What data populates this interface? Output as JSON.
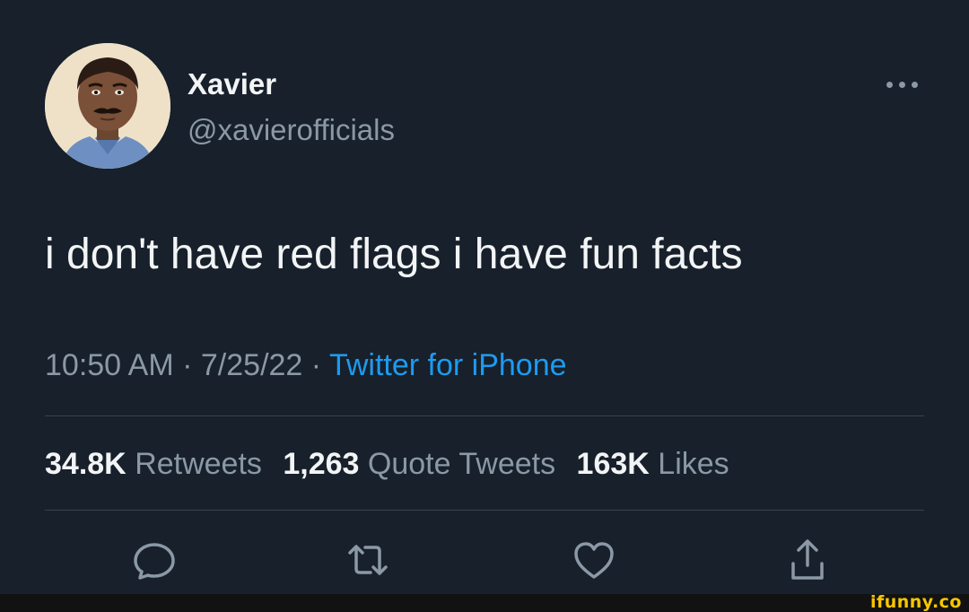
{
  "author": {
    "display_name": "Xavier",
    "handle": "@xavierofficials"
  },
  "tweet": {
    "text": "i don't have red flags i have fun facts",
    "time": "10:50 AM",
    "date": "7/25/22",
    "separator": "·",
    "source": "Twitter for iPhone"
  },
  "stats": {
    "retweets": {
      "count": "34.8K",
      "label": "Retweets"
    },
    "quotes": {
      "count": "1,263",
      "label": "Quote Tweets"
    },
    "likes": {
      "count": "163K",
      "label": "Likes"
    }
  },
  "actions": {
    "icons": [
      "reply-icon",
      "retweet-icon",
      "like-icon",
      "share-icon"
    ]
  },
  "colors": {
    "background": "#17202b",
    "text_primary": "#f2f4f5",
    "text_secondary": "#8b98a5",
    "link": "#1d9bf0",
    "divider": "#38444d"
  },
  "watermark": "ifunny.co"
}
